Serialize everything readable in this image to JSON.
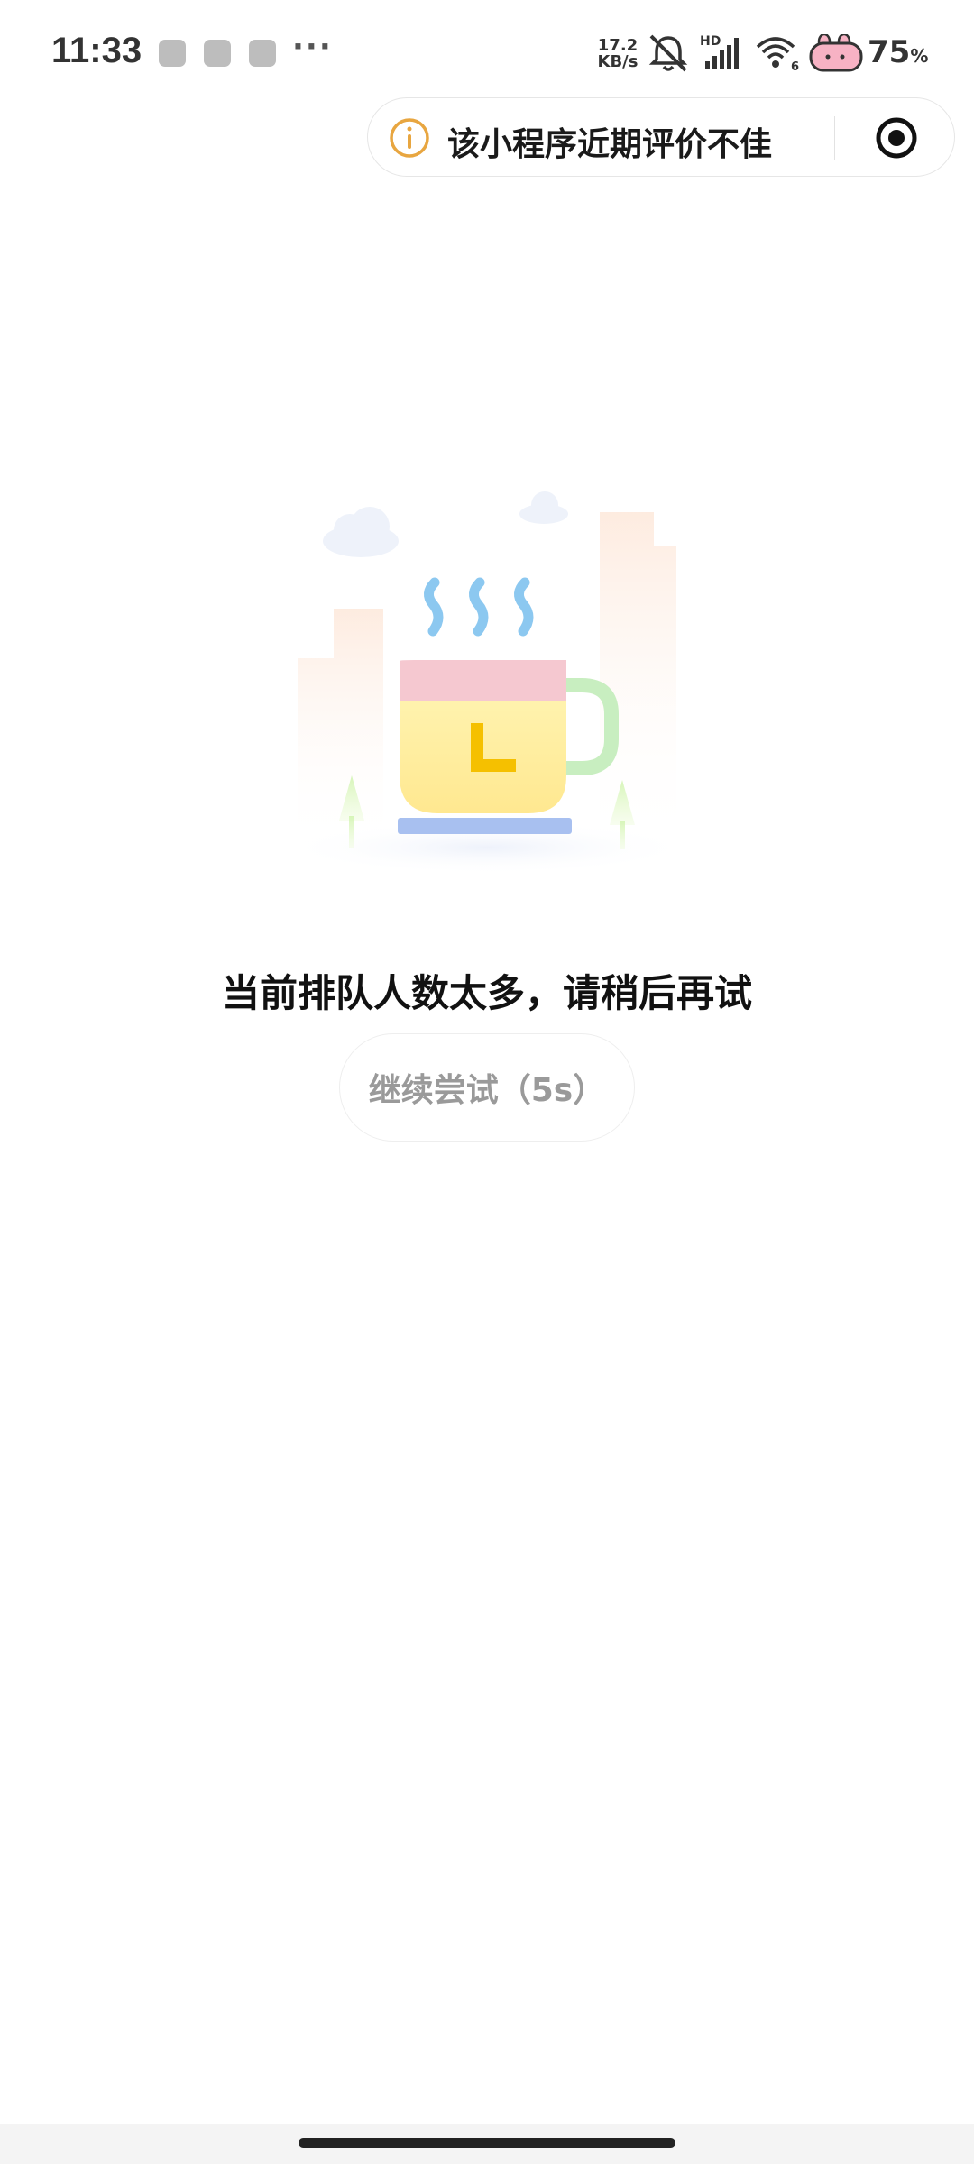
{
  "status_bar": {
    "time": "11:33",
    "notification_icons": [
      "wechat-icon",
      "fish-app-icon",
      "weibo-icon"
    ],
    "more_indicator": "···",
    "net_speed_value": "17.2",
    "net_speed_unit": "KB/s",
    "signal_label": "HD",
    "wifi_label": "6",
    "battery_value": "75",
    "battery_unit": "%"
  },
  "capsule": {
    "warning_text": "该小程序近期评价不佳",
    "accent_color": "#E8A640"
  },
  "main": {
    "message": "当前排队人数太多，请稍后再试",
    "retry_label": "继续尝试（5s）"
  },
  "illustration": {
    "name": "coffee-cup-clock-illustration",
    "colors": {
      "cup": "#FFF0A0",
      "lid": "#F5C8D0",
      "handle": "#C8EEC0",
      "clock": "#F5C000",
      "saucer": "#A8C0F0",
      "steam": "#8CC8F0"
    }
  }
}
